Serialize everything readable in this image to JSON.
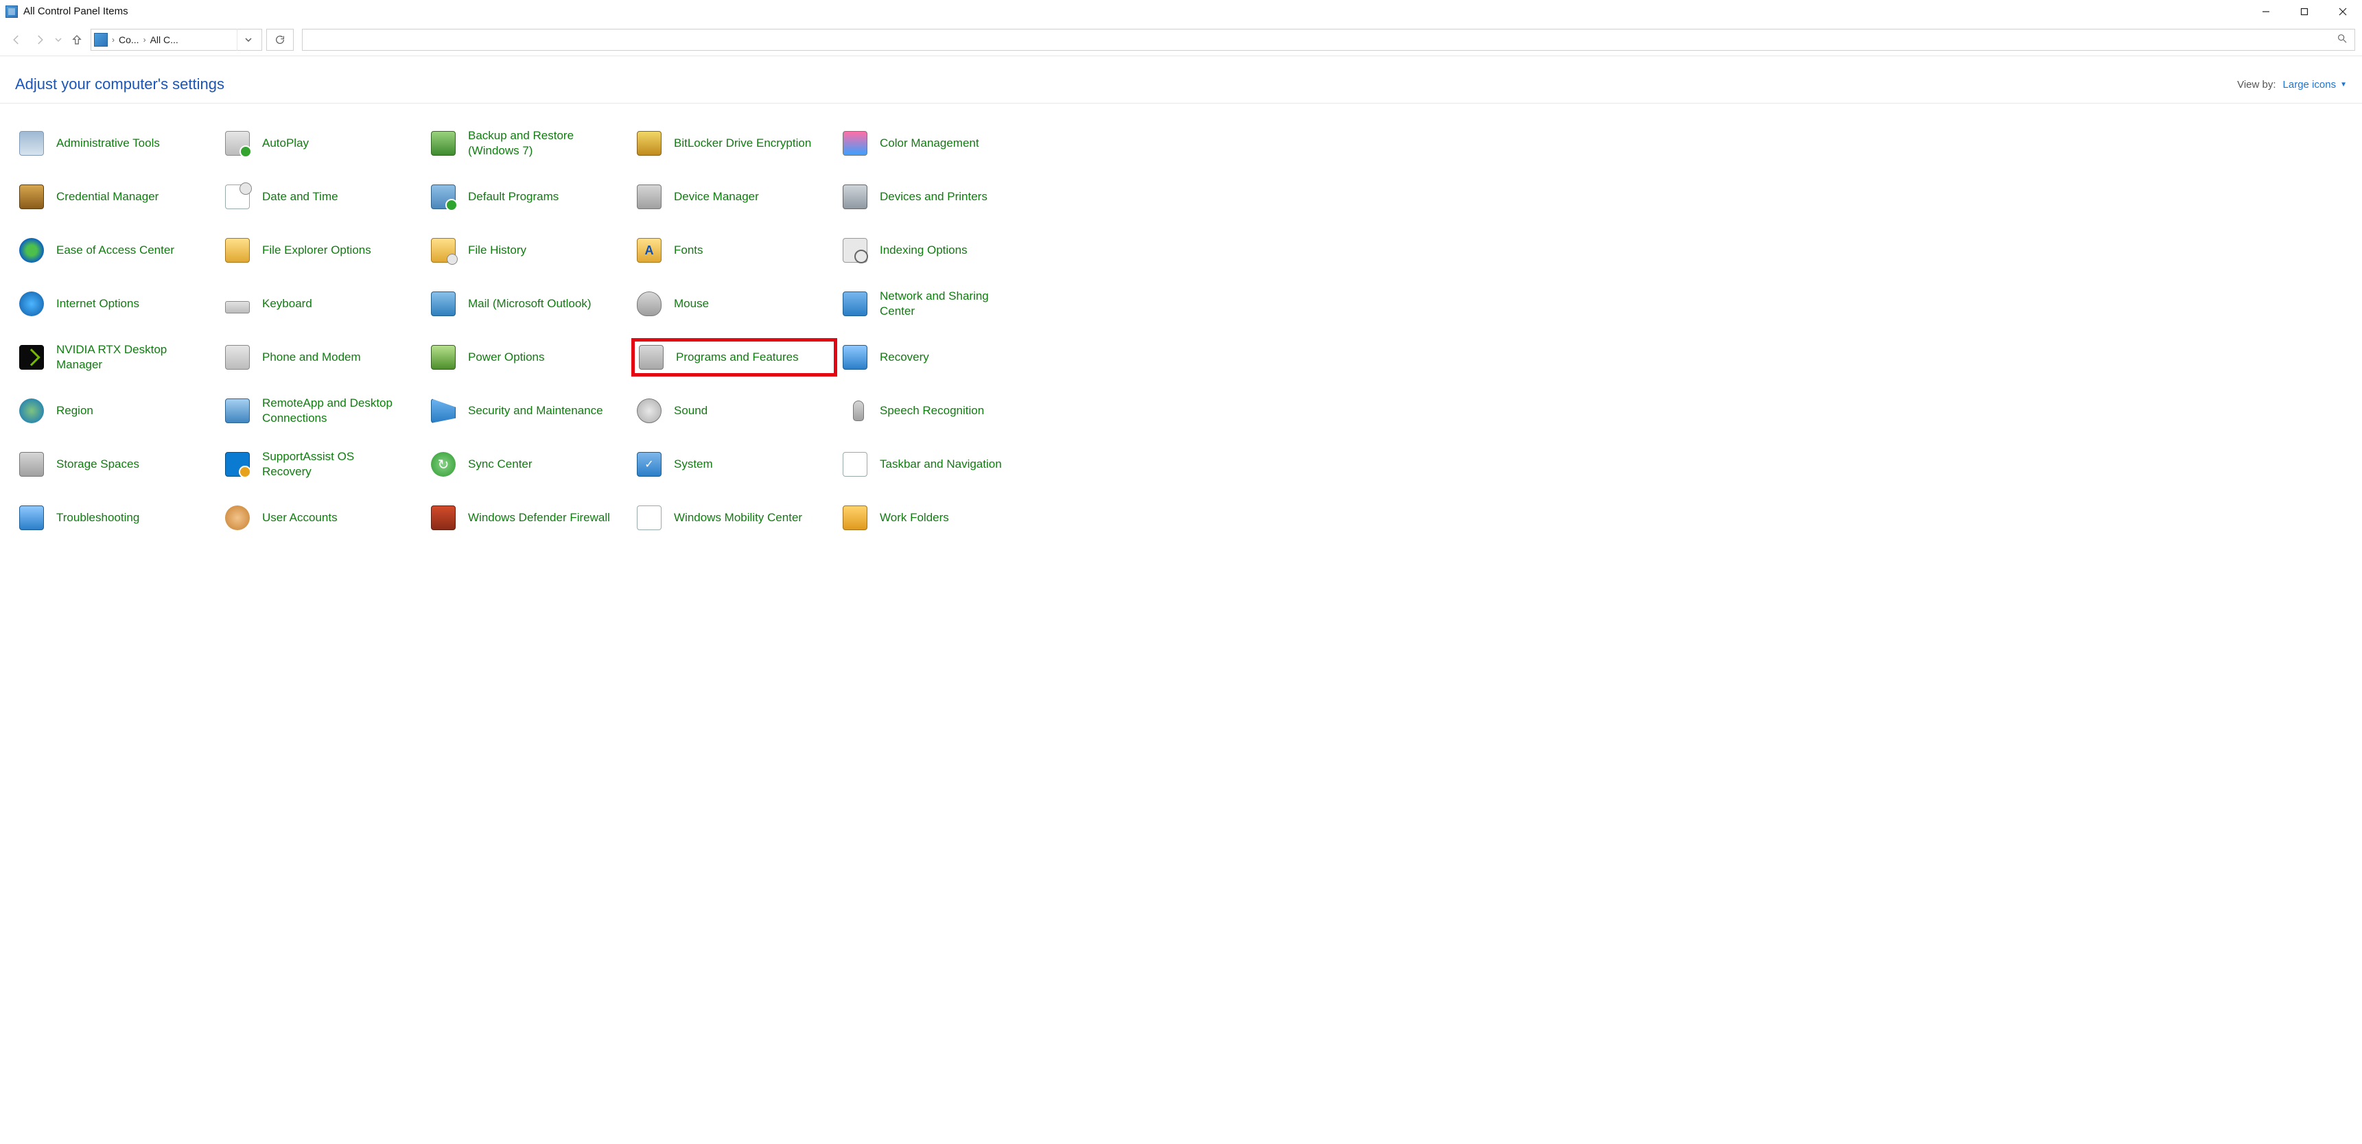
{
  "window": {
    "title": "All Control Panel Items"
  },
  "nav": {
    "addr_seg1": "Co...",
    "addr_seg2": "All C..."
  },
  "header": {
    "title": "Adjust your computer's settings",
    "viewby_label": "View by:",
    "viewby_value": "Large icons"
  },
  "items": [
    {
      "label": "Administrative Tools",
      "icon": "ic-admin",
      "highlight": false
    },
    {
      "label": "AutoPlay",
      "icon": "ic-autoplay",
      "highlight": false
    },
    {
      "label": "Backup and Restore (Windows 7)",
      "icon": "ic-backup",
      "highlight": false
    },
    {
      "label": "BitLocker Drive Encryption",
      "icon": "ic-bitlock",
      "highlight": false
    },
    {
      "label": "Color Management",
      "icon": "ic-color",
      "highlight": false
    },
    {
      "label": "Credential Manager",
      "icon": "ic-cred",
      "highlight": false
    },
    {
      "label": "Date and Time",
      "icon": "ic-datetime",
      "highlight": false
    },
    {
      "label": "Default Programs",
      "icon": "ic-defprog",
      "highlight": false
    },
    {
      "label": "Device Manager",
      "icon": "ic-devmgr",
      "highlight": false
    },
    {
      "label": "Devices and Printers",
      "icon": "ic-devprn",
      "highlight": false
    },
    {
      "label": "Ease of Access Center",
      "icon": "ic-ease",
      "highlight": false
    },
    {
      "label": "File Explorer Options",
      "icon": "ic-feopt",
      "highlight": false
    },
    {
      "label": "File History",
      "icon": "ic-filehist",
      "highlight": false
    },
    {
      "label": "Fonts",
      "icon": "ic-fonts",
      "highlight": false
    },
    {
      "label": "Indexing Options",
      "icon": "ic-index",
      "highlight": false
    },
    {
      "label": "Internet Options",
      "icon": "ic-inetopt",
      "highlight": false
    },
    {
      "label": "Keyboard",
      "icon": "ic-keyboard",
      "highlight": false
    },
    {
      "label": "Mail (Microsoft Outlook)",
      "icon": "ic-mail",
      "highlight": false
    },
    {
      "label": "Mouse",
      "icon": "ic-mouse",
      "highlight": false
    },
    {
      "label": "Network and Sharing Center",
      "icon": "ic-netshr",
      "highlight": false
    },
    {
      "label": "NVIDIA RTX Desktop Manager",
      "icon": "ic-nvidia",
      "highlight": false
    },
    {
      "label": "Phone and Modem",
      "icon": "ic-phone",
      "highlight": false
    },
    {
      "label": "Power Options",
      "icon": "ic-power",
      "highlight": false
    },
    {
      "label": "Programs and Features",
      "icon": "ic-progfeat",
      "highlight": true
    },
    {
      "label": "Recovery",
      "icon": "ic-recovery",
      "highlight": false
    },
    {
      "label": "Region",
      "icon": "ic-region",
      "highlight": false
    },
    {
      "label": "RemoteApp and Desktop Connections",
      "icon": "ic-remote",
      "highlight": false
    },
    {
      "label": "Security and Maintenance",
      "icon": "ic-secmnt",
      "highlight": false
    },
    {
      "label": "Sound",
      "icon": "ic-sound",
      "highlight": false
    },
    {
      "label": "Speech Recognition",
      "icon": "ic-speech",
      "highlight": false
    },
    {
      "label": "Storage Spaces",
      "icon": "ic-storage",
      "highlight": false
    },
    {
      "label": "SupportAssist OS Recovery",
      "icon": "ic-support",
      "highlight": false
    },
    {
      "label": "Sync Center",
      "icon": "ic-sync",
      "highlight": false
    },
    {
      "label": "System",
      "icon": "ic-system",
      "highlight": false
    },
    {
      "label": "Taskbar and Navigation",
      "icon": "ic-taskbar",
      "highlight": false
    },
    {
      "label": "Troubleshooting",
      "icon": "ic-trouble",
      "highlight": false
    },
    {
      "label": "User Accounts",
      "icon": "ic-users",
      "highlight": false
    },
    {
      "label": "Windows Defender Firewall",
      "icon": "ic-wdfw",
      "highlight": false
    },
    {
      "label": "Windows Mobility Center",
      "icon": "ic-wmc",
      "highlight": false
    },
    {
      "label": "Work Folders",
      "icon": "ic-workfld",
      "highlight": false
    }
  ]
}
